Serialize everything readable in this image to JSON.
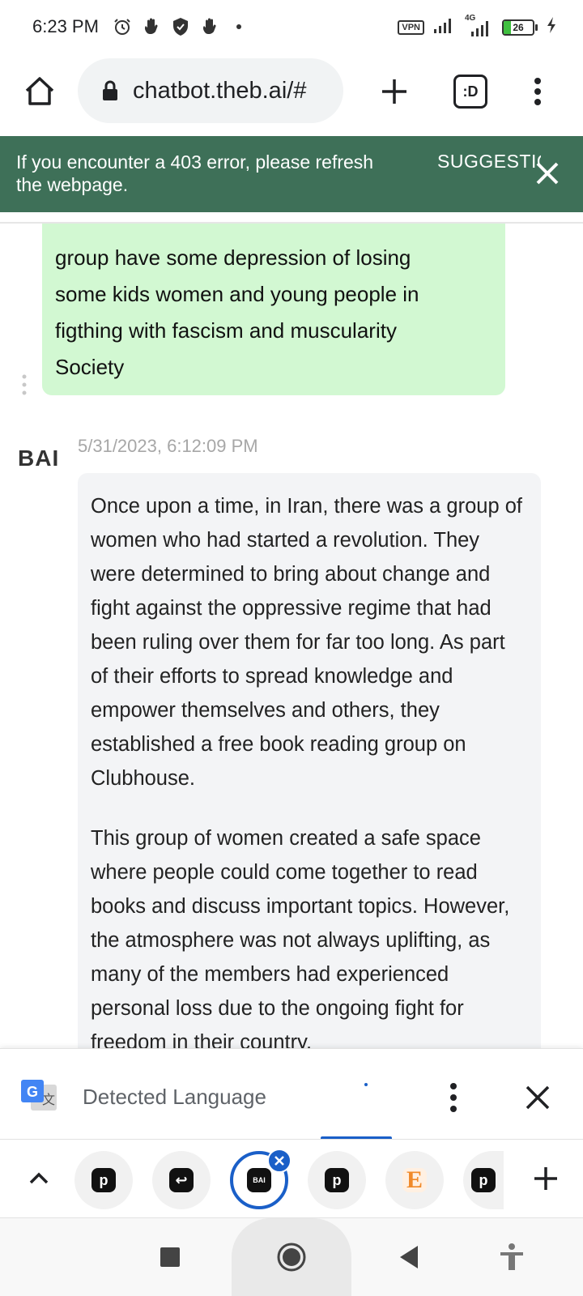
{
  "status_bar": {
    "time": "6:23 PM",
    "vpn": "VPN",
    "network": "4G",
    "battery": "26",
    "battery_level": 0.26
  },
  "browser": {
    "url": "chatbot.theb.ai/#",
    "tabs_icon_label": ":D"
  },
  "banner": {
    "message": "If you encounter a 403 error, please refresh the webpage.",
    "action": "SUGGESTIO"
  },
  "chat": {
    "user_message_lines": [
      "group have some depression of losing",
      "some kids women and young people in",
      "figthing with fascism and muscularity",
      "Society"
    ],
    "bot_avatar": "BAI",
    "bot_timestamp": "5/31/2023, 6:12:09 PM",
    "bot_paragraphs": [
      "Once upon a time, in Iran, there was a group of women who had started a revolution. They were determined to bring about change and fight against the oppressive regime that had been ruling over them for far too long. As part of their efforts to spread knowledge and empower themselves and others, they established a free book reading group on Clubhouse.",
      "This group of women created a safe space where people could come together to read books and discuss important topics. However, the atmosphere was not always uplifting, as many of the members had experienced personal loss due to the ongoing fight for freedom in their country."
    ]
  },
  "translate_bar": {
    "label": "Detected Language"
  },
  "tab_strip": {
    "tabs": [
      {
        "icon": "p-icon",
        "glyph": "p"
      },
      {
        "icon": "return-icon",
        "glyph": "↩"
      },
      {
        "icon": "bai-icon",
        "glyph": "BAI",
        "active": true
      },
      {
        "icon": "p-icon",
        "glyph": "p"
      },
      {
        "icon": "etsy-icon",
        "glyph": "E"
      },
      {
        "icon": "p-icon",
        "glyph": "p"
      }
    ]
  },
  "colors": {
    "banner": "#3e7058",
    "user_bubble": "#d2f8d2",
    "bot_bubble": "#f3f4f6",
    "accent": "#1a5fc8"
  }
}
